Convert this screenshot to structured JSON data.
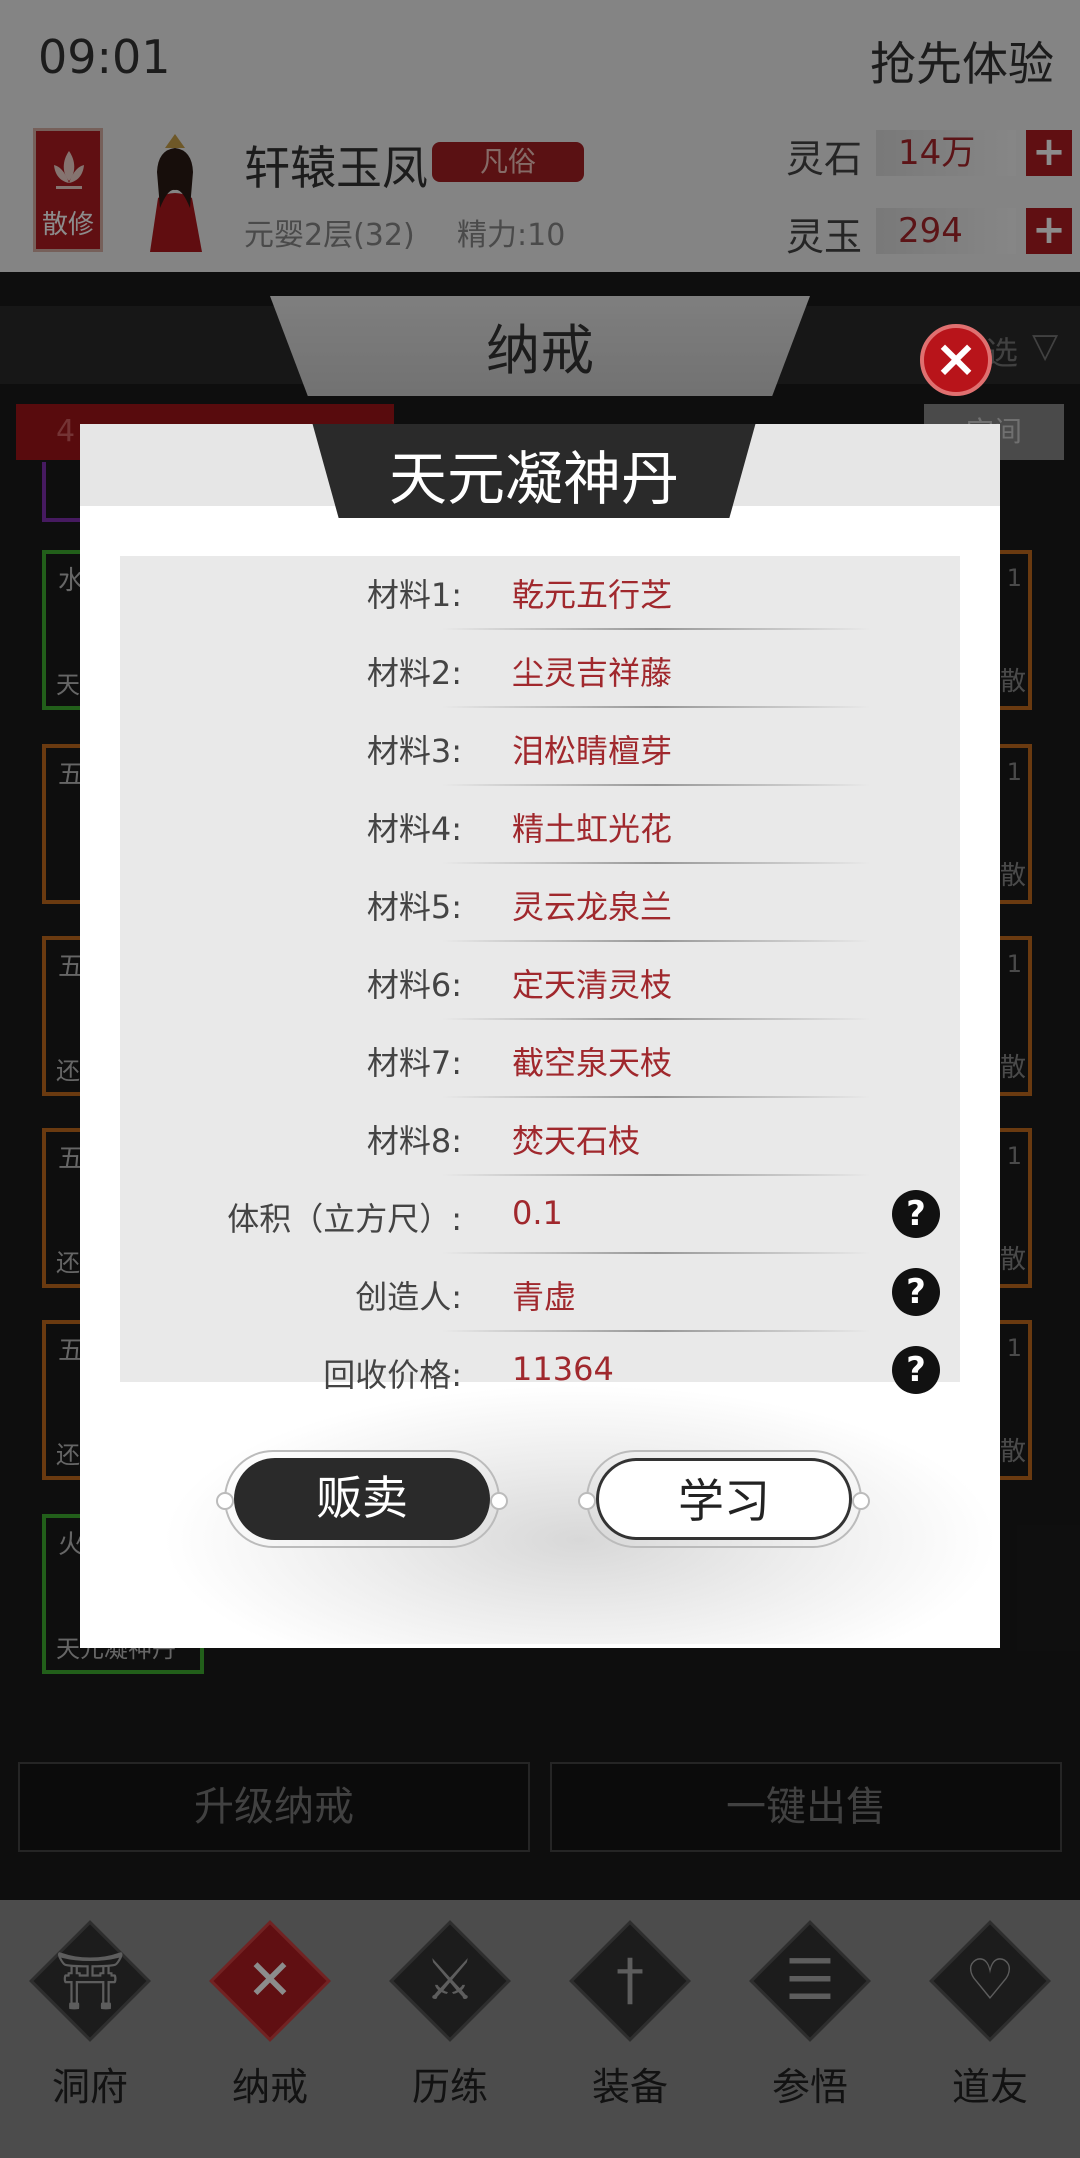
{
  "status": {
    "time": "09:01",
    "right_text": "抢先体验"
  },
  "player": {
    "sect_label": "散修",
    "name": "轩辕玉凤",
    "rank": "凡俗",
    "realm": "元婴2层(32)",
    "energy": "精力:10"
  },
  "resources": [
    {
      "label": "灵石",
      "value": "14万"
    },
    {
      "label": "灵玉",
      "value": "294"
    }
  ],
  "inventory": {
    "title": "纳戒",
    "filter_label": "选",
    "tab_left": "4",
    "tab_right": "空间",
    "items": [
      {
        "name": "水",
        "sub": "天",
        "color": "green"
      },
      {
        "name": "五",
        "sub": "",
        "color": "orange"
      },
      {
        "name": "五",
        "sub": "还",
        "color": "orange"
      },
      {
        "name": "五",
        "sub": "还",
        "color": "orange"
      },
      {
        "name": "五",
        "sub": "还",
        "color": "orange"
      },
      {
        "name": "火",
        "sub": "天元凝神丹",
        "color": "green"
      }
    ],
    "item_count": "1",
    "item_scatter": "散",
    "upgrade_label": "升级纳戒",
    "sell_all_label": "一键出售"
  },
  "modal": {
    "title": "天元凝神丹",
    "rows": [
      {
        "label": "材料1:",
        "value": "乾元五行芝"
      },
      {
        "label": "材料2:",
        "value": "尘灵吉祥藤"
      },
      {
        "label": "材料3:",
        "value": "泪松睛檀芽"
      },
      {
        "label": "材料4:",
        "value": "精土虹光花"
      },
      {
        "label": "材料5:",
        "value": "灵云龙泉兰"
      },
      {
        "label": "材料6:",
        "value": "定天清灵枝"
      },
      {
        "label": "材料7:",
        "value": "截空泉天枝"
      },
      {
        "label": "材料8:",
        "value": "焚天石枝"
      },
      {
        "label": "体积（立方尺）:",
        "value": "0.1"
      },
      {
        "label": "创造人:",
        "value": "青虚"
      },
      {
        "label": "回收价格:",
        "value": "11364"
      }
    ],
    "help_glyph": "?",
    "sell_button": "贩卖",
    "learn_button": "学习"
  },
  "nav": [
    {
      "label": "洞府",
      "icon": "gate-icon",
      "glyph": "⛩"
    },
    {
      "label": "纳戒",
      "icon": "close-x-icon",
      "glyph": "✕"
    },
    {
      "label": "历练",
      "icon": "crossed-swords-icon",
      "glyph": "⚔"
    },
    {
      "label": "装备",
      "icon": "dagger-icon",
      "glyph": "†"
    },
    {
      "label": "参悟",
      "icon": "book-icon",
      "glyph": "☰"
    },
    {
      "label": "道友",
      "icon": "handshake-icon",
      "glyph": "♡"
    }
  ],
  "colors": {
    "accent_red": "#b01d22",
    "value_red": "#a0282d",
    "item_orange": "#c26a1e",
    "item_green": "#3fae30",
    "item_purple": "#8030b0"
  }
}
